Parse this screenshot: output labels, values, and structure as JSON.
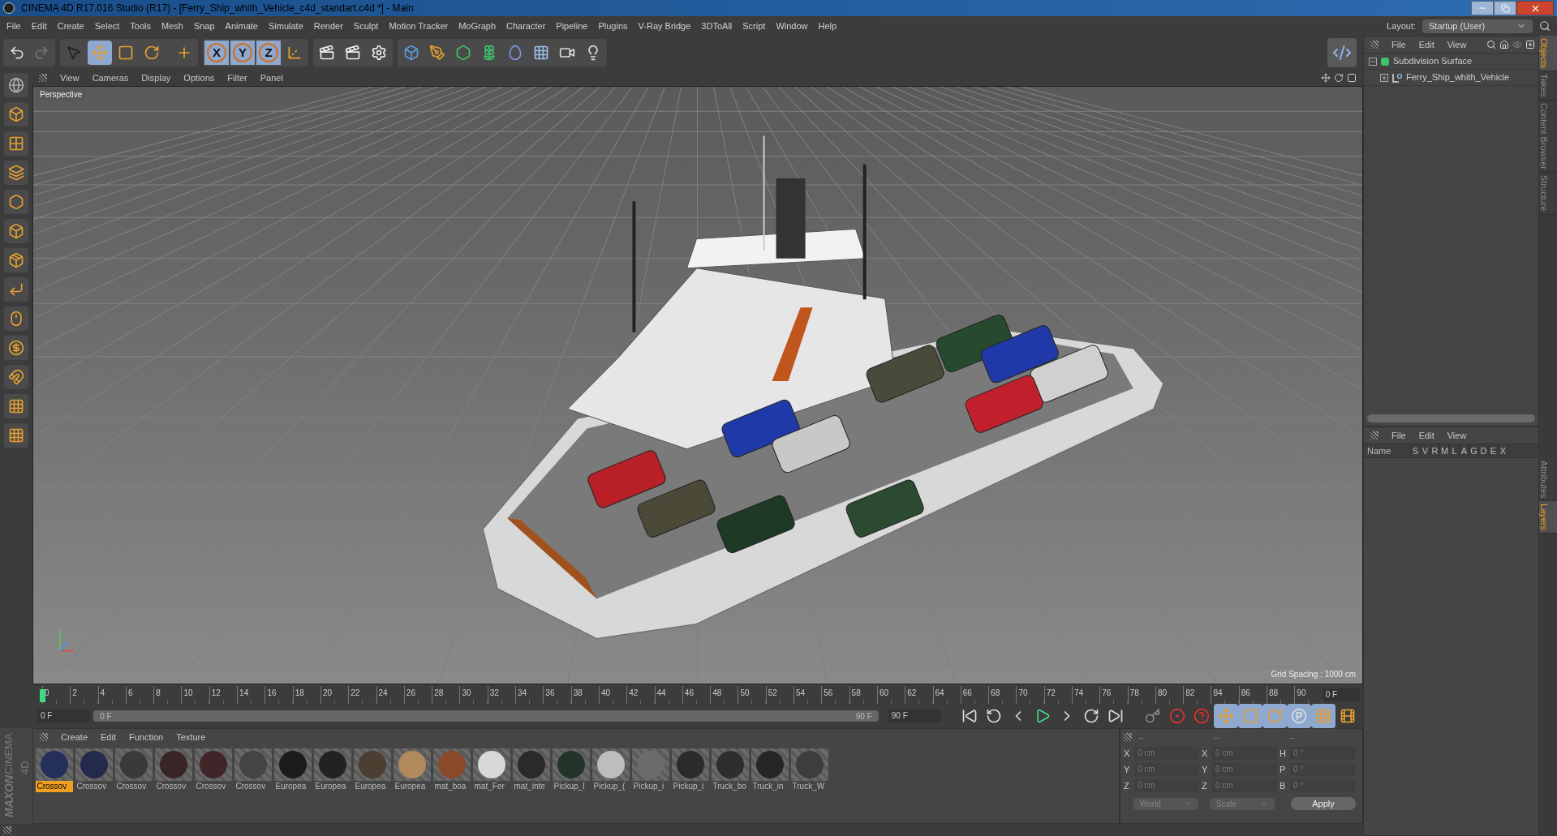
{
  "window": {
    "title": "CINEMA 4D R17.016 Studio (R17) - [Ferry_Ship_whith_Vehicle_c4d_standart.c4d *] - Main"
  },
  "menu": [
    "File",
    "Edit",
    "Create",
    "Select",
    "Tools",
    "Mesh",
    "Snap",
    "Animate",
    "Simulate",
    "Render",
    "Sculpt",
    "Motion Tracker",
    "MoGraph",
    "Character",
    "Pipeline",
    "Plugins",
    "V-Ray Bridge",
    "3DToAll",
    "Script",
    "Window",
    "Help"
  ],
  "layout": {
    "label": "Layout:",
    "value": "Startup (User)"
  },
  "toolbar": {
    "tools": [
      {
        "kind": "select",
        "selected": false
      },
      {
        "kind": "move",
        "selected": true
      },
      {
        "kind": "scale",
        "selected": false
      },
      {
        "kind": "rotate",
        "selected": false
      },
      {
        "kind": "last",
        "selected": false
      }
    ],
    "axes": [
      {
        "label": "X",
        "selected": true
      },
      {
        "label": "Y",
        "selected": true
      },
      {
        "label": "Z",
        "selected": true
      }
    ]
  },
  "viewport": {
    "menu": [
      "View",
      "Cameras",
      "Display",
      "Options",
      "Filter",
      "Panel"
    ],
    "label": "Perspective",
    "grid_spacing": "Grid Spacing : 1000 cm"
  },
  "object_manager": {
    "menu": [
      "File",
      "Edit",
      "View"
    ],
    "objects": [
      {
        "name": "Subdivision Surface",
        "kind": "subdivision",
        "expanded": true,
        "children": [
          {
            "name": "Ferry_Ship_whith_Vehicle",
            "kind": "null",
            "expanded": false
          }
        ]
      }
    ]
  },
  "side_tabs_top": [
    {
      "label": "Objects",
      "selected": true
    },
    {
      "label": "Takes",
      "selected": false
    },
    {
      "label": "Content Browser",
      "selected": false
    },
    {
      "label": "Structure",
      "selected": false
    }
  ],
  "layer_manager": {
    "menu": [
      "File",
      "Edit",
      "View"
    ],
    "columns": [
      "Name",
      "S",
      "V",
      "R",
      "M",
      "L",
      "A",
      "G",
      "D",
      "E",
      "X"
    ]
  },
  "side_tabs_bottom": [
    {
      "label": "Attributes",
      "selected": false
    },
    {
      "label": "Layers",
      "selected": true
    }
  ],
  "timeline": {
    "ticks": [
      "0",
      "2",
      "4",
      "6",
      "8",
      "10",
      "12",
      "14",
      "16",
      "18",
      "20",
      "22",
      "24",
      "26",
      "28",
      "30",
      "32",
      "34",
      "36",
      "38",
      "40",
      "42",
      "44",
      "46",
      "48",
      "50",
      "52",
      "54",
      "56",
      "58",
      "60",
      "62",
      "64",
      "66",
      "68",
      "70",
      "72",
      "74",
      "76",
      "78",
      "80",
      "82",
      "84",
      "86",
      "88",
      "90"
    ],
    "frame": "0 F"
  },
  "transport": {
    "level": 1,
    "start": "0 F",
    "range_start": "0 F",
    "range_end": "90 F",
    "end": "90 F"
  },
  "material_manager": {
    "menu": [
      "Create",
      "Edit",
      "Function",
      "Texture"
    ],
    "materials": [
      {
        "name": "Crossov",
        "color": "#24305a",
        "selected": true
      },
      {
        "name": "Crossov",
        "color": "#232a4a",
        "selected": false
      },
      {
        "name": "Crossov",
        "color": "#3a3a3a",
        "selected": false
      },
      {
        "name": "Crossov",
        "color": "#3a2526",
        "selected": false
      },
      {
        "name": "Crossov",
        "color": "#402628",
        "selected": false
      },
      {
        "name": "Crossov",
        "color": "#444444",
        "selected": false
      },
      {
        "name": "Europea",
        "color": "#1c1c1c",
        "selected": false
      },
      {
        "name": "Europea",
        "color": "#222222",
        "selected": false
      },
      {
        "name": "Europea",
        "color": "#4a3e30",
        "selected": false
      },
      {
        "name": "Europea",
        "color": "#b08a5c",
        "selected": false
      },
      {
        "name": "mat_boa",
        "color": "#8a4a2a",
        "selected": false
      },
      {
        "name": "mat_Fer",
        "color": "#d8d8d8",
        "selected": false
      },
      {
        "name": "mat_inte",
        "color": "#2a2a2a",
        "selected": false
      },
      {
        "name": "Pickup_I",
        "color": "#23352a",
        "selected": false
      },
      {
        "name": "Pickup_(",
        "color": "#bdbdbd",
        "selected": false
      },
      {
        "name": "Pickup_i",
        "color": "#6b6b6b",
        "selected": false
      },
      {
        "name": "Pickup_i",
        "color": "#2b2b2b",
        "selected": false
      },
      {
        "name": "Truck_bo",
        "color": "#2e2e2e",
        "selected": false
      },
      {
        "name": "Truck_in",
        "color": "#262626",
        "selected": false
      },
      {
        "name": "Truck_W",
        "color": "#3d3d3d",
        "selected": false
      }
    ]
  },
  "coordinates": {
    "headers": [
      "--",
      "--",
      "--"
    ],
    "rows": [
      {
        "label_1": "X",
        "value_1": "0 cm",
        "label_2": "X",
        "value_2": "0 cm",
        "label_3": "H",
        "value_3": "0 °"
      },
      {
        "label_1": "Y",
        "value_1": "0 cm",
        "label_2": "Y",
        "value_2": "0 cm",
        "label_3": "P",
        "value_3": "0 °"
      },
      {
        "label_1": "Z",
        "value_1": "0 cm",
        "label_2": "Z",
        "value_2": "0 cm",
        "label_3": "B",
        "value_3": "0 °"
      }
    ],
    "mode": "World",
    "transform": "Scale",
    "apply": "Apply"
  },
  "logo": {
    "brand": "MAXON",
    "product": "CINEMA 4D"
  }
}
